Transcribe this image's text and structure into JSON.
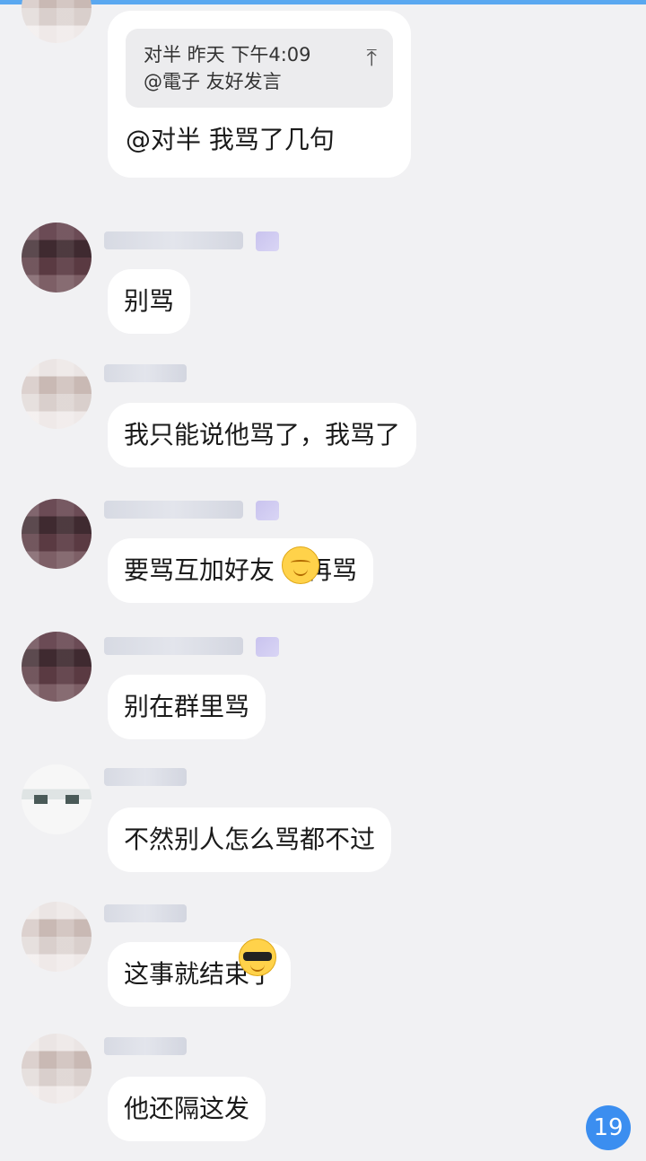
{
  "reply": {
    "header": "对半 昨天 下午4:09",
    "quoted": "@電子 友好发言",
    "text": "@对半 我骂了几句"
  },
  "messages": [
    {
      "text": "别骂"
    },
    {
      "text": "我只能说他骂了，我骂了"
    },
    {
      "text": "要骂互加好友",
      "text_after": "再骂",
      "emoji": "smile-emoji"
    },
    {
      "text": "别在群里骂"
    },
    {
      "text": "不然别人怎么骂都不过"
    },
    {
      "text": "这事就结束了",
      "emoji": "sunglasses-emoji"
    },
    {
      "text": "他还隔这发"
    }
  ],
  "unread_count": "19",
  "colors": {
    "accent": "#3b8ef0",
    "bubble": "#ffffff",
    "background": "#f1f1f3"
  }
}
